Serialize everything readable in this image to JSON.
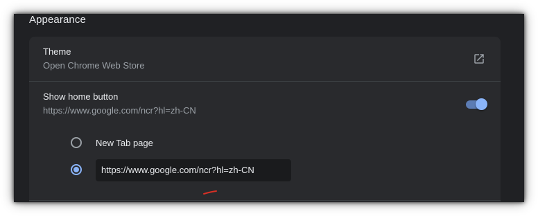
{
  "section": {
    "title": "Appearance"
  },
  "theme": {
    "title": "Theme",
    "subtitle": "Open Chrome Web Store",
    "icon": "open-in-new-icon"
  },
  "home_button": {
    "title": "Show home button",
    "subtitle": "https://www.google.com/ncr?hl=zh-CN",
    "toggle_on": true,
    "options": [
      {
        "label": "New Tab page",
        "selected": false
      },
      {
        "label": "https://www.google.com/ncr?hl=zh-CN",
        "selected": true
      }
    ],
    "custom_url_value": "https://www.google.com/ncr?hl=zh-CN"
  },
  "colors": {
    "background": "#202124",
    "card": "#292a2d",
    "accent": "#8ab4f8",
    "annotation": "#d93025"
  }
}
